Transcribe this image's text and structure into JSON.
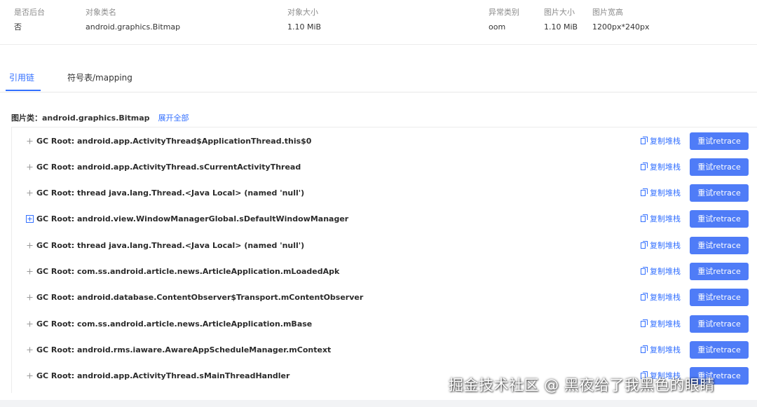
{
  "info": {
    "columns": [
      {
        "header": "是否后台",
        "value": "否"
      },
      {
        "header": "对象类名",
        "value": "android.graphics.Bitmap"
      },
      {
        "header": "对象大小",
        "value": "1.10 MiB"
      },
      {
        "header": "异常类别",
        "value": "oom"
      },
      {
        "header": "图片大小",
        "value": "1.10 MiB"
      },
      {
        "header": "图片宽高",
        "value": "1200px*240px"
      }
    ]
  },
  "tabs": [
    {
      "label": "引用链",
      "active": true
    },
    {
      "label": "符号表/mapping",
      "active": false
    }
  ],
  "heading": {
    "title": "图片类：android.graphics.Bitmap",
    "expand_all": "展开全部"
  },
  "rows": [
    {
      "text": "GC Root: android.app.ActivityThread$ApplicationThread.this$0",
      "copy": "复制堆栈",
      "retrace": "重试retrace"
    },
    {
      "text": "GC Root: android.app.ActivityThread.sCurrentActivityThread",
      "copy": "复制堆栈",
      "retrace": "重试retrace"
    },
    {
      "text": "GC Root: thread java.lang.Thread.<Java Local> (named 'null')",
      "copy": "复制堆栈",
      "retrace": "重试retrace"
    },
    {
      "text": "GC Root: android.view.WindowManagerGlobal.sDefaultWindowManager",
      "copy": "复制堆栈",
      "retrace": "重试retrace"
    },
    {
      "text": "GC Root: thread java.lang.Thread.<Java Local> (named 'null')",
      "copy": "复制堆栈",
      "retrace": "重试retrace"
    },
    {
      "text": "GC Root: com.ss.android.article.news.ArticleApplication.mLoadedApk",
      "copy": "复制堆栈",
      "retrace": "重试retrace"
    },
    {
      "text": "GC Root: android.database.ContentObserver$Transport.mContentObserver",
      "copy": "复制堆栈",
      "retrace": "重试retrace"
    },
    {
      "text": "GC Root: com.ss.android.article.news.ArticleApplication.mBase",
      "copy": "复制堆栈",
      "retrace": "重试retrace"
    },
    {
      "text": "GC Root: android.rms.iaware.AwareAppScheduleManager.mContext",
      "copy": "复制堆栈",
      "retrace": "重试retrace"
    },
    {
      "text": "GC Root: android.app.ActivityThread.sMainThreadHandler",
      "copy": "复制堆栈",
      "retrace": "重试retrace"
    }
  ],
  "watermark": "掘金技术社区 @ 黑夜给了我黑色的眼睛",
  "colors": {
    "accent": "#3370ff",
    "button": "#4f7cf7"
  },
  "icons": {
    "expand": "plus-icon",
    "copy": "copy-icon"
  }
}
